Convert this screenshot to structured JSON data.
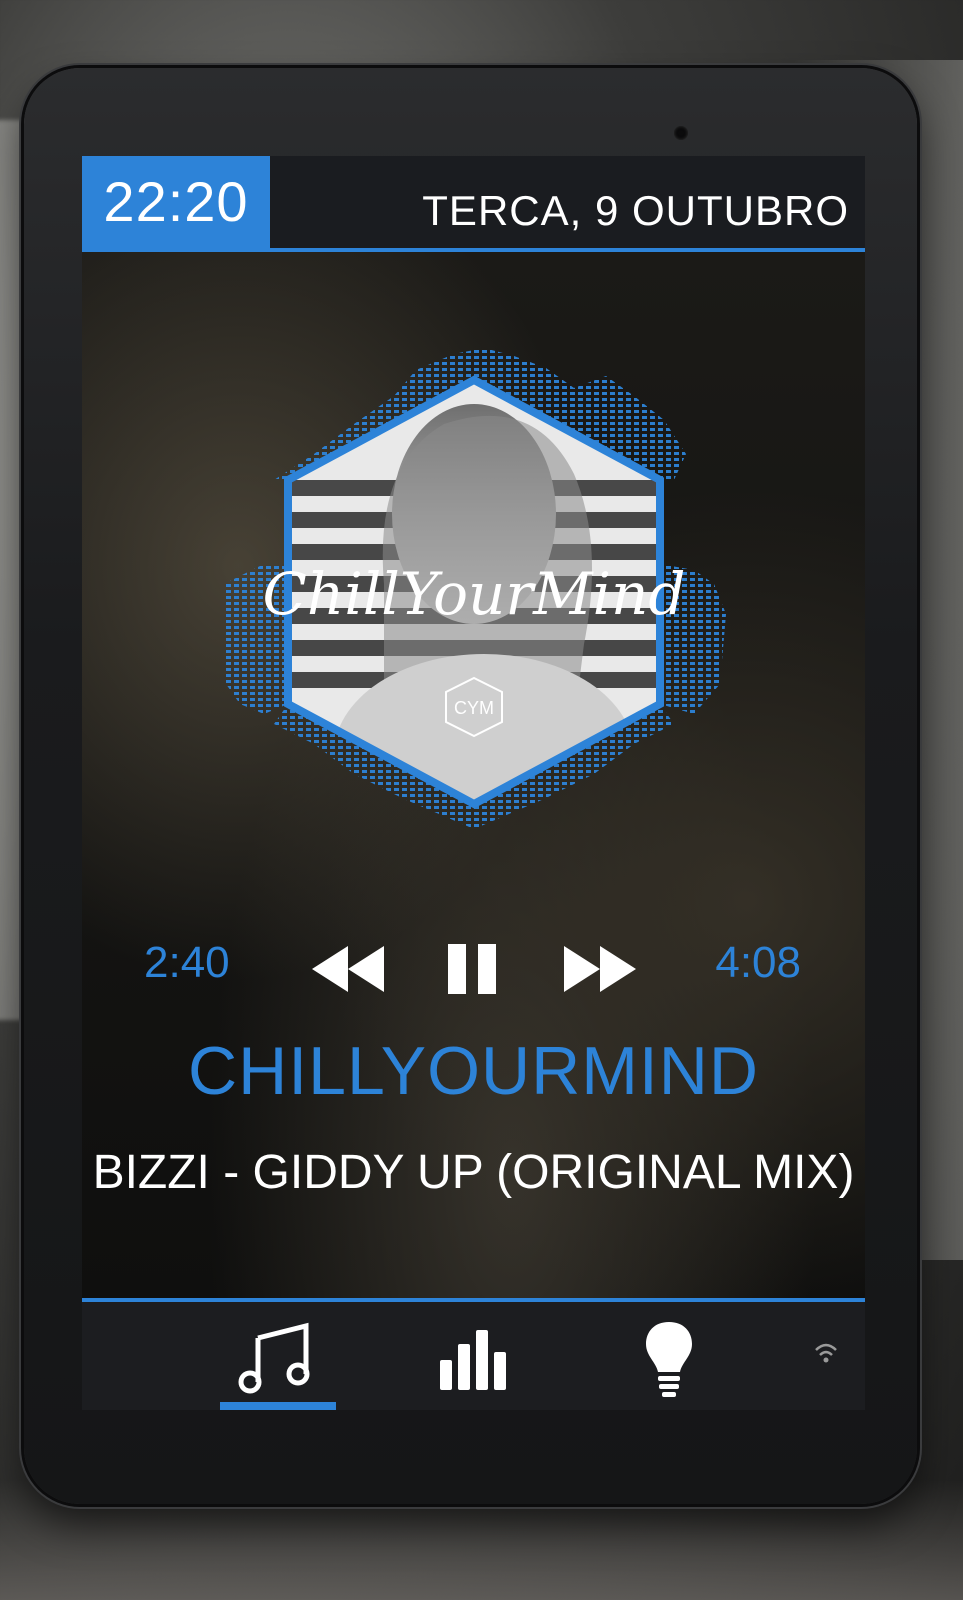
{
  "status": {
    "time": "22:20",
    "date": "TERCA, 9 OUTUBRO"
  },
  "artwork": {
    "logo_text": "ChillYourMind",
    "badge_text": "CYM"
  },
  "player": {
    "current_time": "2:40",
    "total_time": "4:08",
    "state": "playing"
  },
  "now_playing": {
    "channel": "CHILLYOURMIND",
    "track": "BIZZI - GIDDY UP (ORIGINAL MIX)"
  },
  "nav": {
    "items": [
      {
        "icon": "music-note-icon",
        "active": true
      },
      {
        "icon": "equalizer-icon",
        "active": false
      },
      {
        "icon": "lightbulb-icon",
        "active": false
      },
      {
        "icon": "wifi-icon",
        "active": false
      }
    ]
  },
  "colors": {
    "accent": "#2d83d8",
    "bar": "#1a1c20",
    "text": "#ffffff"
  }
}
